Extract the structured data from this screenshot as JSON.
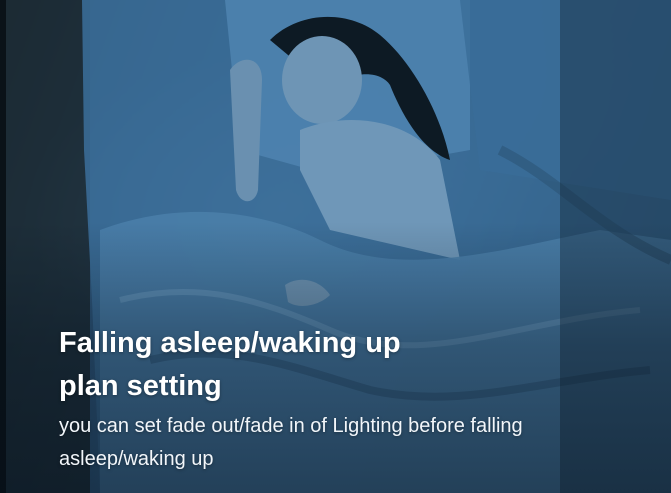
{
  "card": {
    "title": "Falling asleep/waking up plan setting",
    "description": "you can set fade out/fade in of Lighting before falling asleep/waking up",
    "text_color": "#ffffff",
    "image_tint": "#3b6f9c"
  }
}
